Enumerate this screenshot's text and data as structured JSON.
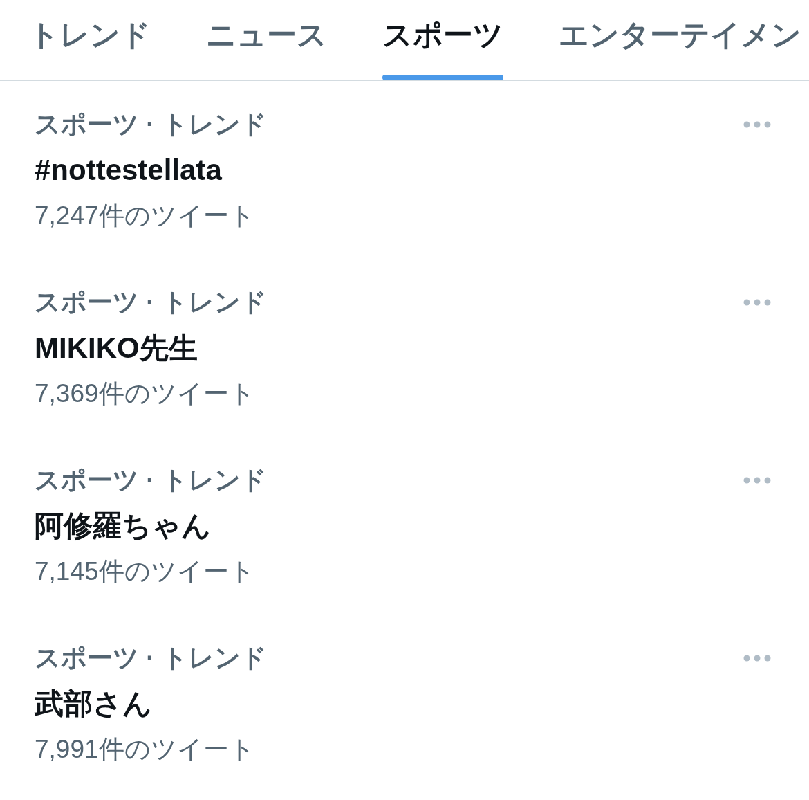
{
  "tabs": [
    {
      "label": "トレンド",
      "selected": false
    },
    {
      "label": "ニュース",
      "selected": false
    },
    {
      "label": "スポーツ",
      "selected": true
    },
    {
      "label": "エンターテイメン",
      "selected": false
    }
  ],
  "trends": [
    {
      "category": "スポーツ · トレンド",
      "title": "#nottestellata",
      "count": "7,247件のツイート"
    },
    {
      "category": "スポーツ · トレンド",
      "title": "MIKIKO先生",
      "count": "7,369件のツイート"
    },
    {
      "category": "スポーツ · トレンド",
      "title": "阿修羅ちゃん",
      "count": "7,145件のツイート"
    },
    {
      "category": "スポーツ · トレンド",
      "title": "武部さん",
      "count": "7,991件のツイート"
    }
  ]
}
